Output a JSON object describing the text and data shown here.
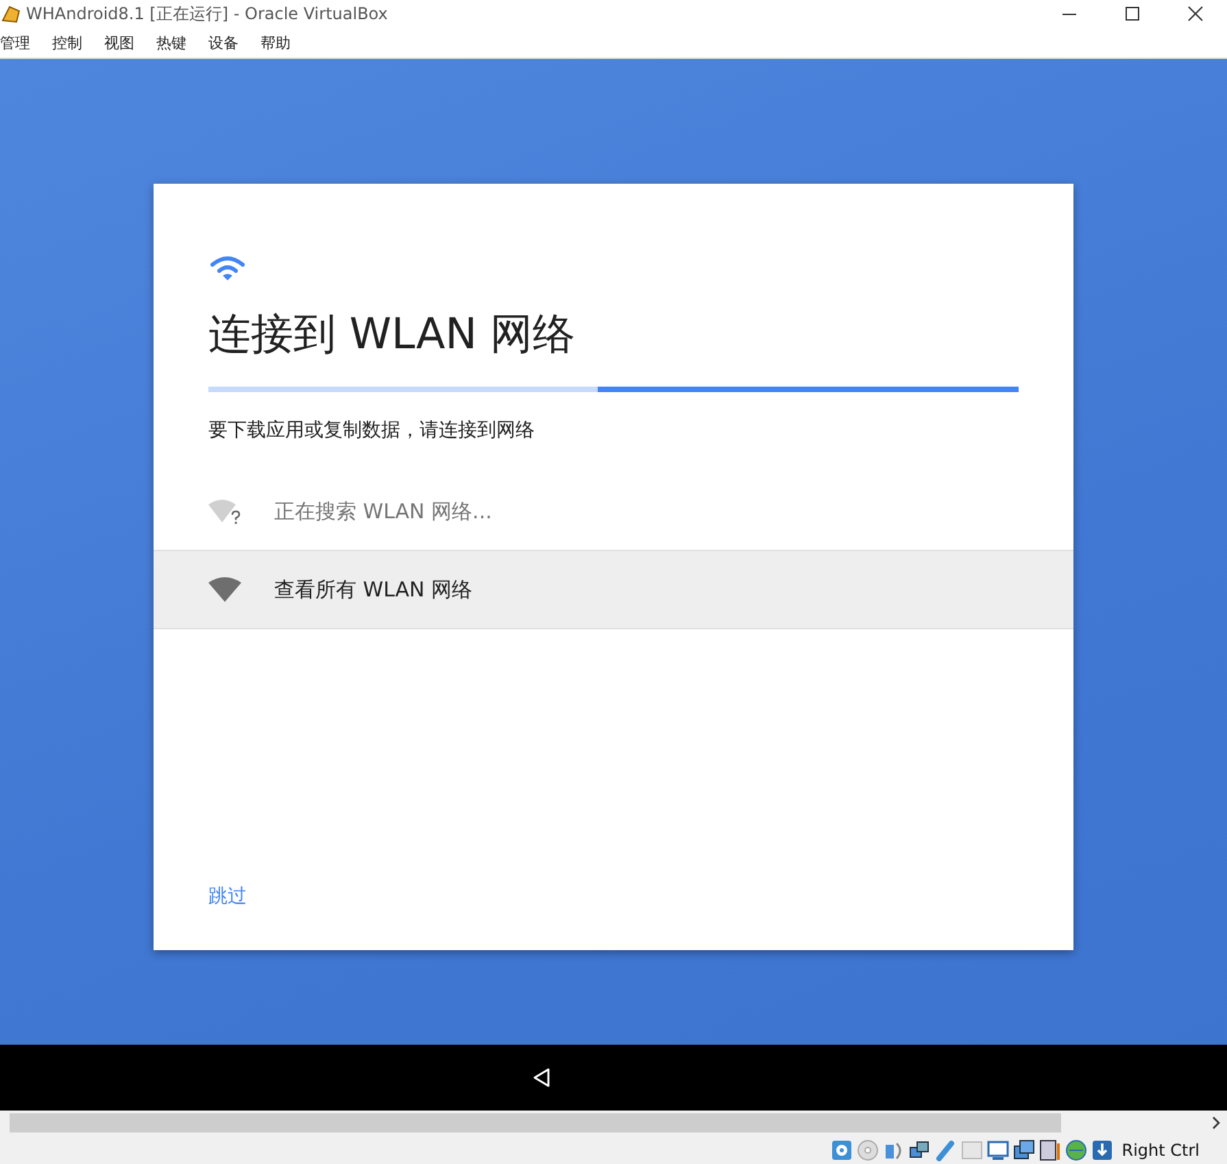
{
  "window": {
    "title": "WHAndroid8.1 [正在运行] - Oracle VirtualBox"
  },
  "menu": [
    {
      "label": "管理"
    },
    {
      "label": "控制"
    },
    {
      "label": "视图"
    },
    {
      "label": "热键"
    },
    {
      "label": "设备"
    },
    {
      "label": "帮助"
    }
  ],
  "setup": {
    "title": "连接到 WLAN 网络",
    "progress": {
      "level": 0.52
    },
    "subtitle": "要下载应用或复制数据，请连接到网络",
    "items": [
      {
        "kind": "searching",
        "label": "正在搜索 WLAN 网络...",
        "highlighted": false
      },
      {
        "kind": "action",
        "label": "查看所有 WLAN 网络",
        "highlighted": true
      }
    ],
    "skip": "跳过"
  },
  "status_bar": {
    "host_key": "Right Ctrl"
  }
}
